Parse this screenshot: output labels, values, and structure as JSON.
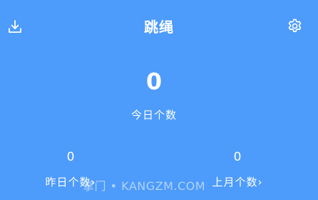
{
  "header": {
    "title": "跳绳",
    "download_icon": "download-icon",
    "settings_icon": "gear-icon"
  },
  "today": {
    "count": "0",
    "label": "今日个数"
  },
  "yesterday": {
    "count": "0",
    "label": "昨日个数",
    "chevron": "›"
  },
  "last_month": {
    "count": "0",
    "label": "上月个数",
    "chevron": "›"
  },
  "watermark": "掌门 • KANGZM.COM",
  "colors": {
    "background": "#4d9bfb",
    "text": "#ffffff"
  }
}
